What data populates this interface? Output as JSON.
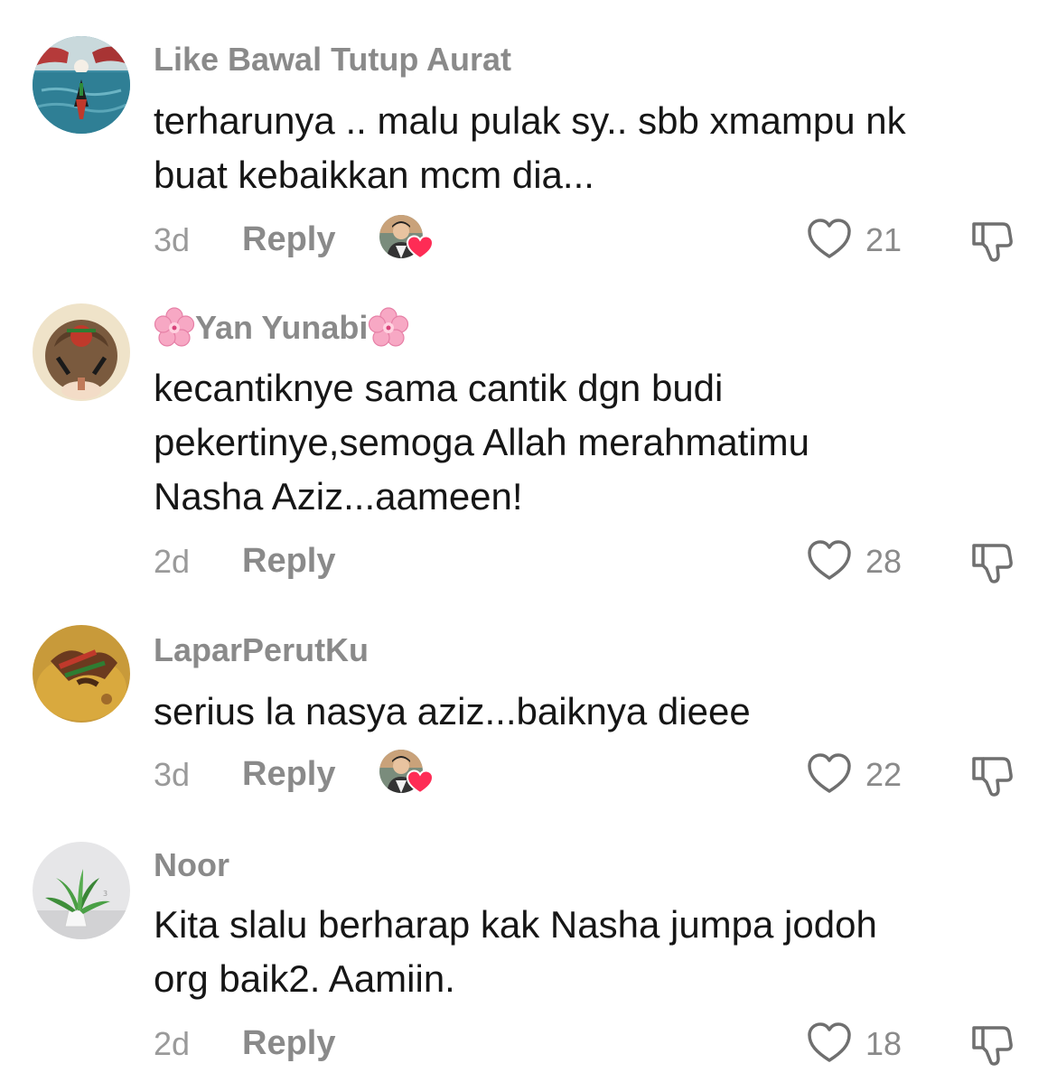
{
  "comments": [
    {
      "username": "Like Bawal Tutup Aurat",
      "text": "terharunya .. malu pulak sy.. sbb xmampu nk\nbuat kebaikkan mcm dia...",
      "time": "3d",
      "reply_label": "Reply",
      "likes": "21",
      "liked_by_creator": true
    },
    {
      "username": "Yan Yunabi",
      "username_decoration": "cherry-blossom",
      "text": "kecantiknye sama cantik dgn budi\npekertinye,semoga Allah merahmatimu\nNasha Aziz...aameen!",
      "time": "2d",
      "reply_label": "Reply",
      "likes": "28",
      "liked_by_creator": false
    },
    {
      "username": "LaparPerutKu",
      "text": "serius la nasya aziz...baiknya dieee",
      "time": "3d",
      "reply_label": "Reply",
      "likes": "22",
      "liked_by_creator": true
    },
    {
      "username": "Noor",
      "text": "Kita slalu berharap kak Nasha jumpa jodoh\norg baik2. Aamiin.",
      "time": "2d",
      "reply_label": "Reply",
      "likes": "18",
      "liked_by_creator": false
    }
  ],
  "colors": {
    "text": "#161616",
    "secondary": "#8a8a8a",
    "creator_heart": "#fe2c55"
  },
  "icons": {
    "like": "heart-outline-icon",
    "dislike": "thumbs-down-icon",
    "creator_like": "creator-liked-heart-icon"
  }
}
